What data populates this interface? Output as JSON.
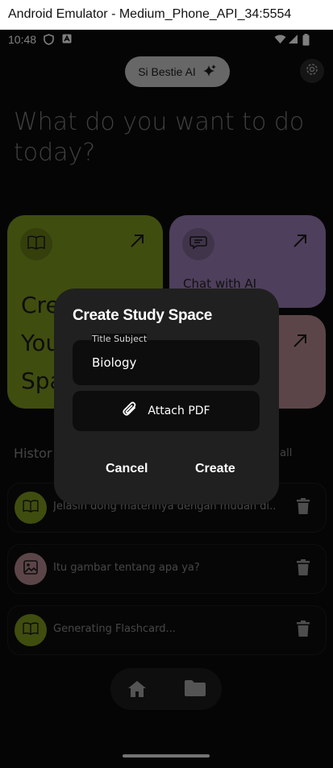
{
  "window": {
    "title": "Android Emulator - Medium_Phone_API_34:5554"
  },
  "status_bar": {
    "time": "10:48"
  },
  "app": {
    "brand_pill": "Si Bestie AI",
    "headline_line1": "What do you want to do",
    "headline_line2": "today?",
    "cards": {
      "create_label_line1": "Cre",
      "create_label_line2": "You",
      "create_label_line3": "Spa",
      "chat_label": "Chat with AI"
    },
    "history": {
      "title": "Histor",
      "see_all": "e all",
      "items": [
        {
          "text": "Jelasin dong materinya dengan mudah di...",
          "avatar_color": "#7f9a1f",
          "icon": "book-icon"
        },
        {
          "text": "Itu gambar tentang apa ya?",
          "avatar_color": "#b88b91",
          "icon": "image-icon"
        },
        {
          "text": "Generating Flashcard...",
          "avatar_color": "#7f9a1f",
          "icon": "book-icon"
        }
      ]
    }
  },
  "dialog": {
    "title": "Create Study Space",
    "field_label": "Title Subject",
    "field_value": "Biology",
    "attach_label": "Attach PDF",
    "cancel_label": "Cancel",
    "create_label": "Create"
  },
  "colors": {
    "green_card": "#7f9a1f",
    "purple_card": "#9d7fb8",
    "pink_card": "#b88b91",
    "dialog_bg": "#202020"
  }
}
